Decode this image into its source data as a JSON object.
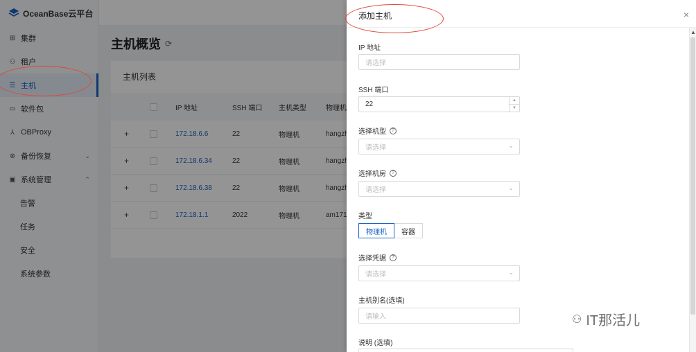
{
  "app": {
    "name": "OceanBase云平台"
  },
  "sidebar": {
    "items": [
      {
        "label": "集群",
        "icon": "grid-icon"
      },
      {
        "label": "租户",
        "icon": "org-tree-icon"
      },
      {
        "label": "主机",
        "icon": "host-list-icon",
        "active": true
      },
      {
        "label": "软件包",
        "icon": "folder-icon"
      },
      {
        "label": "OBProxy",
        "icon": "proxy-icon"
      },
      {
        "label": "备份恢复",
        "icon": "backup-icon",
        "chevron": "down"
      },
      {
        "label": "系统管理",
        "icon": "system-icon",
        "chevron": "up"
      }
    ],
    "sub_items": [
      {
        "label": "告警"
      },
      {
        "label": "任务"
      },
      {
        "label": "安全"
      },
      {
        "label": "系统参数"
      }
    ]
  },
  "page": {
    "title": "主机概览",
    "card_title": "主机列表",
    "table": {
      "columns": [
        "IP 地址",
        "SSH 端口",
        "主机类型",
        "物理机"
      ],
      "rows": [
        {
          "ip": "172.18.6.6",
          "port": "22",
          "type": "物理机",
          "machine": "hangzh"
        },
        {
          "ip": "172.18.6.34",
          "port": "22",
          "type": "物理机",
          "machine": "hangzh"
        },
        {
          "ip": "172.18.6.38",
          "port": "22",
          "type": "物理机",
          "machine": "hangzh"
        },
        {
          "ip": "172.18.1.1",
          "port": "2022",
          "type": "物理机",
          "machine": "am171"
        }
      ]
    }
  },
  "drawer": {
    "title": "添加主机",
    "close": "×",
    "fields": {
      "ip": {
        "label": "IP 地址",
        "placeholder": "请选择"
      },
      "ssh_port": {
        "label": "SSH 端口",
        "value": "22"
      },
      "model": {
        "label": "选择机型",
        "placeholder": "请选择"
      },
      "room": {
        "label": "选择机房",
        "placeholder": "请选择"
      },
      "type": {
        "label": "类型",
        "options": [
          "物理机",
          "容器"
        ],
        "selected": "物理机"
      },
      "credential": {
        "label": "选择凭据",
        "placeholder": "请选择"
      },
      "alias": {
        "label": "主机别名(选填)",
        "placeholder": "请输入"
      },
      "desc": {
        "label": "说明 (选填)"
      }
    }
  },
  "watermark": {
    "text": "IT那活儿"
  },
  "colors": {
    "accent": "#1b63c3",
    "annotation": "#e0473a"
  }
}
